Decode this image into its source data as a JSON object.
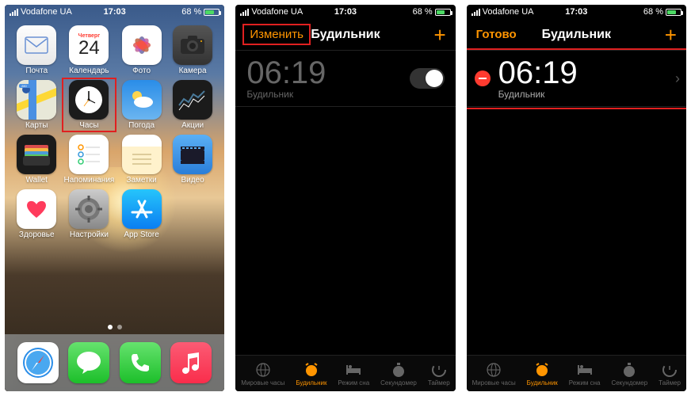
{
  "status": {
    "carrier": "Vodafone UA",
    "time": "17:03",
    "battery": "68 %"
  },
  "home": {
    "apps": [
      {
        "label": "Почта",
        "name": "mail-app"
      },
      {
        "label": "Календарь",
        "name": "calendar-app",
        "badge": "Четверг",
        "day": "24"
      },
      {
        "label": "Фото",
        "name": "photos-app"
      },
      {
        "label": "Камера",
        "name": "camera-app"
      },
      {
        "label": "Карты",
        "name": "maps-app"
      },
      {
        "label": "Часы",
        "name": "clock-app",
        "highlighted": true
      },
      {
        "label": "Погода",
        "name": "weather-app"
      },
      {
        "label": "Акции",
        "name": "stocks-app"
      },
      {
        "label": "Wallet",
        "name": "wallet-app"
      },
      {
        "label": "Напоминания",
        "name": "reminders-app"
      },
      {
        "label": "Заметки",
        "name": "notes-app"
      },
      {
        "label": "Видео",
        "name": "videos-app"
      },
      {
        "label": "Здоровье",
        "name": "health-app"
      },
      {
        "label": "Настройки",
        "name": "settings-app"
      },
      {
        "label": "App Store",
        "name": "appstore-app"
      }
    ],
    "dock": [
      {
        "name": "safari-app"
      },
      {
        "name": "messages-app"
      },
      {
        "name": "phone-app"
      },
      {
        "name": "music-app"
      }
    ]
  },
  "clock": {
    "title": "Будильник",
    "edit": "Изменить",
    "done": "Готово",
    "add": "+",
    "alarm_time": "06:19",
    "alarm_label": "Будильник",
    "tabs": [
      {
        "label": "Мировые часы",
        "name": "world-clock-tab"
      },
      {
        "label": "Будильник",
        "name": "alarm-tab",
        "active": true
      },
      {
        "label": "Режим сна",
        "name": "bedtime-tab"
      },
      {
        "label": "Секундомер",
        "name": "stopwatch-tab"
      },
      {
        "label": "Таймер",
        "name": "timer-tab"
      }
    ]
  }
}
